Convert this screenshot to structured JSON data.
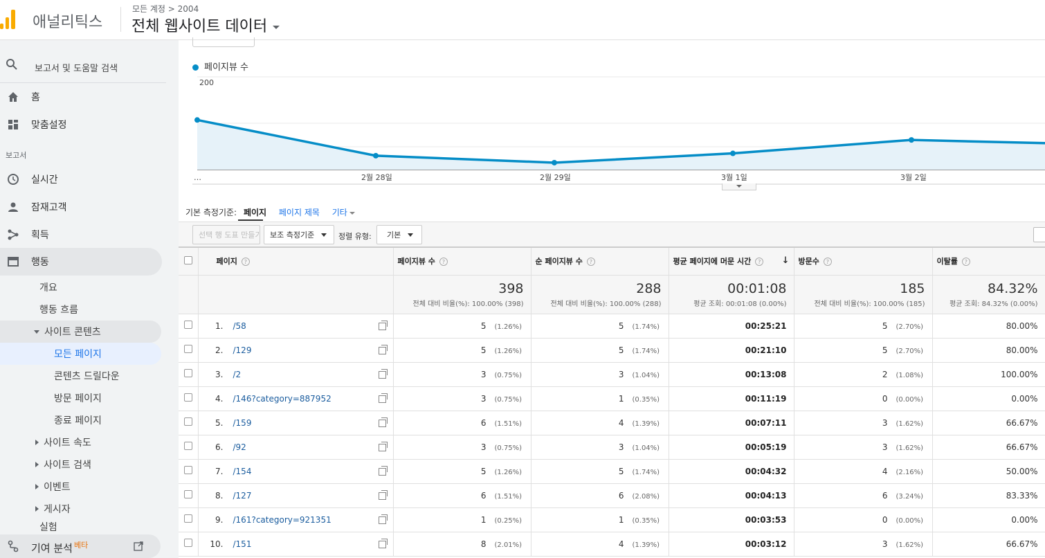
{
  "header": {
    "brand": "애널리틱스",
    "breadcrumb": "모든 계정 > 2004",
    "property": "전체 웹사이트 데이터"
  },
  "sidebar": {
    "search_placeholder": "보고서 및 도움말 검색",
    "home": "홈",
    "customization": "맞춤설정",
    "reports_section": "보고서",
    "realtime": "실시간",
    "audience": "잠재고객",
    "acquisition": "획득",
    "behavior": "행동",
    "behavior_items": {
      "overview": "개요",
      "flow": "행동 흐름",
      "site_content": "사이트 콘텐츠",
      "all_pages": "모든 페이지",
      "drilldown": "콘텐츠 드릴다운",
      "landing": "방문 페이지",
      "exit": "종료 페이지",
      "site_speed": "사이트 속도",
      "site_search": "사이트 검색",
      "events": "이벤트",
      "publisher": "게시자",
      "experiments": "실험"
    },
    "attribution": "기여 분석",
    "beta": "베타"
  },
  "chart_data": {
    "type": "area",
    "series": [
      {
        "name": "페이지뷰 수",
        "values": [
          107,
          30,
          15,
          35,
          64,
          57
        ]
      }
    ],
    "x_positions_label_dates": [
      "2월 28일",
      "2월 29일",
      "3월 1일",
      "3월 2일"
    ],
    "x_leading_label": "…",
    "ylim": [
      0,
      200
    ],
    "yticks": [
      "100",
      "200"
    ],
    "color": "#058dc7"
  },
  "dimension": {
    "label": "기본 측정기준:",
    "current": "페이지",
    "alt": "페이지 제목",
    "more": "기타"
  },
  "toolbar": {
    "plot_rows": "선택 행 도표 만들기",
    "secondary_dim": "보조 측정기준",
    "sort_label": "정렬 유형:",
    "sort_value": "기본"
  },
  "table": {
    "columns": [
      "페이지",
      "페이지뷰 수",
      "순 페이지뷰 수",
      "평균 페이지에 머문 시간",
      "방문수",
      "이탈률"
    ],
    "summary": [
      {
        "value": "398",
        "sub": "전체 대비 비율(%): 100.00% (398)"
      },
      {
        "value": "288",
        "sub": "전체 대비 비율(%): 100.00% (288)"
      },
      {
        "value": "00:01:08",
        "sub": "평균 조회: 00:01:08 (0.00%)"
      },
      {
        "value": "185",
        "sub": "전체 대비 비율(%): 100.00% (185)"
      },
      {
        "value": "84.32%",
        "sub": "평균 조회: 84.32% (0.00%)"
      }
    ],
    "rows": [
      {
        "idx": "1.",
        "page": "/58",
        "pv": "5",
        "pv_pct": "(1.26%)",
        "upv": "5",
        "upv_pct": "(1.74%)",
        "time": "00:25:21",
        "ent": "5",
        "ent_pct": "(2.70%)",
        "bounce": "80.00%"
      },
      {
        "idx": "2.",
        "page": "/129",
        "pv": "5",
        "pv_pct": "(1.26%)",
        "upv": "5",
        "upv_pct": "(1.74%)",
        "time": "00:21:10",
        "ent": "5",
        "ent_pct": "(2.70%)",
        "bounce": "80.00%"
      },
      {
        "idx": "3.",
        "page": "/2",
        "pv": "3",
        "pv_pct": "(0.75%)",
        "upv": "3",
        "upv_pct": "(1.04%)",
        "time": "00:13:08",
        "ent": "2",
        "ent_pct": "(1.08%)",
        "bounce": "100.00%"
      },
      {
        "idx": "4.",
        "page": "/146?category=887952",
        "pv": "3",
        "pv_pct": "(0.75%)",
        "upv": "1",
        "upv_pct": "(0.35%)",
        "time": "00:11:19",
        "ent": "0",
        "ent_pct": "(0.00%)",
        "bounce": "0.00%"
      },
      {
        "idx": "5.",
        "page": "/159",
        "pv": "6",
        "pv_pct": "(1.51%)",
        "upv": "4",
        "upv_pct": "(1.39%)",
        "time": "00:07:11",
        "ent": "3",
        "ent_pct": "(1.62%)",
        "bounce": "66.67%"
      },
      {
        "idx": "6.",
        "page": "/92",
        "pv": "3",
        "pv_pct": "(0.75%)",
        "upv": "3",
        "upv_pct": "(1.04%)",
        "time": "00:05:19",
        "ent": "3",
        "ent_pct": "(1.62%)",
        "bounce": "66.67%"
      },
      {
        "idx": "7.",
        "page": "/154",
        "pv": "5",
        "pv_pct": "(1.26%)",
        "upv": "5",
        "upv_pct": "(1.74%)",
        "time": "00:04:32",
        "ent": "4",
        "ent_pct": "(2.16%)",
        "bounce": "50.00%"
      },
      {
        "idx": "8.",
        "page": "/127",
        "pv": "6",
        "pv_pct": "(1.51%)",
        "upv": "6",
        "upv_pct": "(2.08%)",
        "time": "00:04:13",
        "ent": "6",
        "ent_pct": "(3.24%)",
        "bounce": "83.33%"
      },
      {
        "idx": "9.",
        "page": "/161?category=921351",
        "pv": "1",
        "pv_pct": "(0.25%)",
        "upv": "1",
        "upv_pct": "(0.35%)",
        "time": "00:03:53",
        "ent": "0",
        "ent_pct": "(0.00%)",
        "bounce": "0.00%"
      },
      {
        "idx": "10.",
        "page": "/151",
        "pv": "8",
        "pv_pct": "(2.01%)",
        "upv": "4",
        "upv_pct": "(1.39%)",
        "time": "00:03:12",
        "ent": "3",
        "ent_pct": "(1.62%)",
        "bounce": "66.67%"
      }
    ]
  }
}
